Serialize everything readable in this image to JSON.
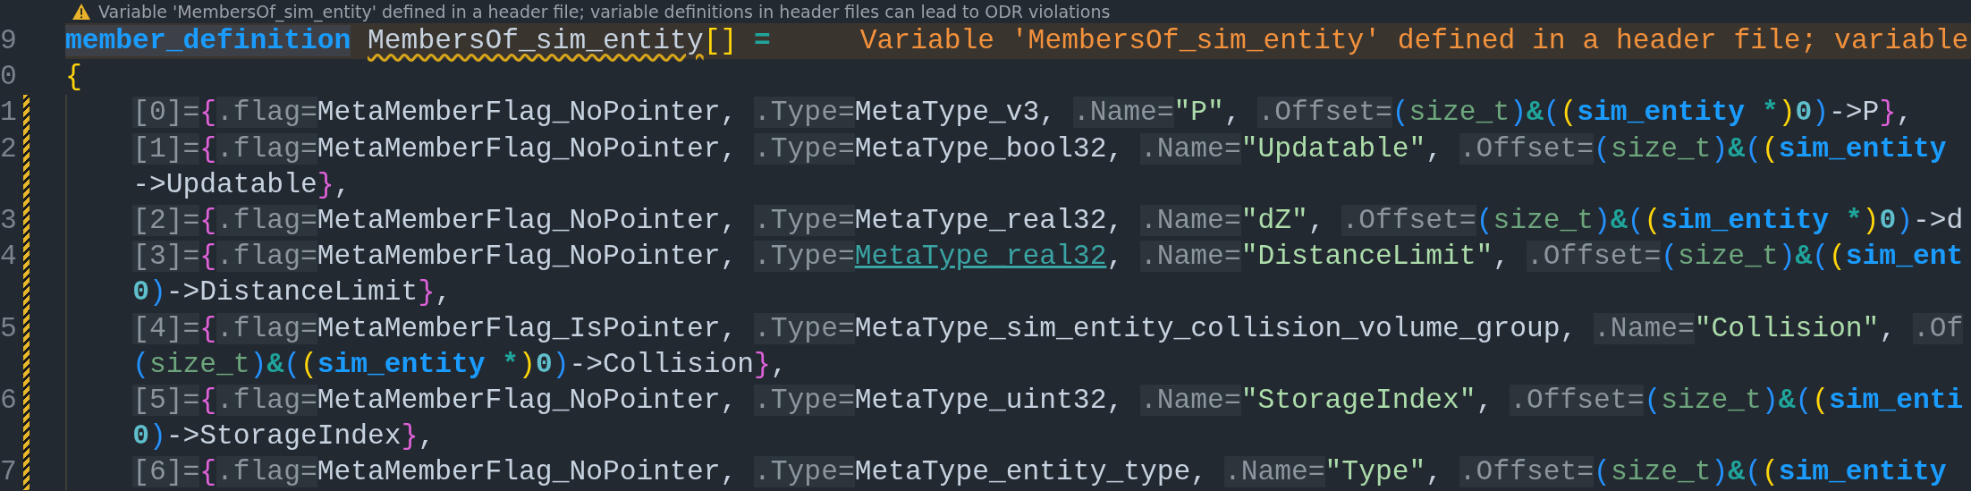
{
  "editor": {
    "codelens": {
      "text": "Variable 'MembersOf_sim_entity' defined in a header file; variable definitions in header files can lead to ODR violations"
    },
    "lines": [
      {
        "number": "9",
        "changed": false,
        "error": "Variable 'MembersOf_sim_entity' defined in a header file; variable",
        "tokens": [
          {
            "kind": "macro",
            "text": "member_definition"
          },
          {
            "kind": "squiggle",
            "text": " MembersOf_sim_entity"
          },
          {
            "kind": "paren-yellow",
            "text": "[]"
          },
          {
            "kind": "op",
            "text": " ="
          }
        ]
      },
      {
        "number": "0",
        "changed": false,
        "tokens": [
          {
            "kind": "brace-yellow",
            "text": "{"
          }
        ]
      },
      {
        "number": "1",
        "changed": true,
        "tokens": [
          {
            "kind": "hint",
            "text": "    [0]="
          },
          {
            "kind": "brace",
            "text": "{"
          },
          {
            "kind": "hint",
            "text": ".flag="
          },
          {
            "kind": "plain",
            "text": "MetaMemberFlag_NoPointer, "
          },
          {
            "kind": "hint",
            "text": ".Type="
          },
          {
            "kind": "plain",
            "text": "MetaType_v3, "
          },
          {
            "kind": "hint",
            "text": ".Name="
          },
          {
            "kind": "string",
            "text": "\"P\""
          },
          {
            "kind": "plain",
            "text": ", "
          },
          {
            "kind": "hint",
            "text": ".Offset="
          },
          {
            "kind": "paren-blue",
            "text": "("
          },
          {
            "kind": "builtin",
            "text": "size_t"
          },
          {
            "kind": "paren-blue",
            "text": ")"
          },
          {
            "kind": "op",
            "text": "&"
          },
          {
            "kind": "paren-blue",
            "text": "("
          },
          {
            "kind": "paren-yellow",
            "text": "("
          },
          {
            "kind": "type",
            "text": "sim_entity"
          },
          {
            "kind": "op",
            "text": " *"
          },
          {
            "kind": "paren-yellow",
            "text": ")"
          },
          {
            "kind": "number",
            "text": "0"
          },
          {
            "kind": "paren-blue",
            "text": ")"
          },
          {
            "kind": "plain",
            "text": "->P"
          },
          {
            "kind": "brace",
            "text": "}"
          },
          {
            "kind": "plain",
            "text": ","
          }
        ]
      },
      {
        "number": "2",
        "changed": true,
        "tokens": [
          {
            "kind": "hint",
            "text": "    [1]="
          },
          {
            "kind": "brace",
            "text": "{"
          },
          {
            "kind": "hint",
            "text": ".flag="
          },
          {
            "kind": "plain",
            "text": "MetaMemberFlag_NoPointer, "
          },
          {
            "kind": "hint",
            "text": ".Type="
          },
          {
            "kind": "plain",
            "text": "MetaType_bool32, "
          },
          {
            "kind": "hint",
            "text": ".Name="
          },
          {
            "kind": "string",
            "text": "\"Updatable\""
          },
          {
            "kind": "plain",
            "text": ", "
          },
          {
            "kind": "hint",
            "text": ".Offset="
          },
          {
            "kind": "paren-blue",
            "text": "("
          },
          {
            "kind": "builtin",
            "text": "size_t"
          },
          {
            "kind": "paren-blue",
            "text": ")"
          },
          {
            "kind": "op",
            "text": "&"
          },
          {
            "kind": "paren-blue",
            "text": "("
          },
          {
            "kind": "paren-yellow",
            "text": "("
          },
          {
            "kind": "type",
            "text": "sim_entity"
          }
        ]
      },
      {
        "changed": true,
        "tokens": [
          {
            "kind": "plain",
            "text": "    ->Updatable"
          },
          {
            "kind": "brace",
            "text": "}"
          },
          {
            "kind": "plain",
            "text": ","
          }
        ]
      },
      {
        "number": "3",
        "changed": true,
        "tokens": [
          {
            "kind": "hint",
            "text": "    [2]="
          },
          {
            "kind": "brace",
            "text": "{"
          },
          {
            "kind": "hint",
            "text": ".flag="
          },
          {
            "kind": "plain",
            "text": "MetaMemberFlag_NoPointer, "
          },
          {
            "kind": "hint",
            "text": ".Type="
          },
          {
            "kind": "plain",
            "text": "MetaType_real32, "
          },
          {
            "kind": "hint",
            "text": ".Name="
          },
          {
            "kind": "string",
            "text": "\"dZ\""
          },
          {
            "kind": "plain",
            "text": ", "
          },
          {
            "kind": "hint",
            "text": ".Offset="
          },
          {
            "kind": "paren-blue",
            "text": "("
          },
          {
            "kind": "builtin",
            "text": "size_t"
          },
          {
            "kind": "paren-blue",
            "text": ")"
          },
          {
            "kind": "op",
            "text": "&"
          },
          {
            "kind": "paren-blue",
            "text": "("
          },
          {
            "kind": "paren-yellow",
            "text": "("
          },
          {
            "kind": "type",
            "text": "sim_entity"
          },
          {
            "kind": "op",
            "text": " *"
          },
          {
            "kind": "paren-yellow",
            "text": ")"
          },
          {
            "kind": "number",
            "text": "0"
          },
          {
            "kind": "paren-blue",
            "text": ")"
          },
          {
            "kind": "plain",
            "text": "->d"
          }
        ]
      },
      {
        "number": "4",
        "changed": true,
        "tokens": [
          {
            "kind": "hint",
            "text": "    [3]="
          },
          {
            "kind": "brace",
            "text": "{"
          },
          {
            "kind": "hint",
            "text": ".flag="
          },
          {
            "kind": "plain",
            "text": "MetaMemberFlag_NoPointer, "
          },
          {
            "kind": "hint",
            "text": ".Type="
          },
          {
            "kind": "link",
            "text": "MetaType_real32"
          },
          {
            "kind": "plain",
            "text": ", "
          },
          {
            "kind": "hint",
            "text": ".Name="
          },
          {
            "kind": "string",
            "text": "\"DistanceLimit\""
          },
          {
            "kind": "plain",
            "text": ", "
          },
          {
            "kind": "hint",
            "text": ".Offset="
          },
          {
            "kind": "paren-blue",
            "text": "("
          },
          {
            "kind": "builtin",
            "text": "size_t"
          },
          {
            "kind": "paren-blue",
            "text": ")"
          },
          {
            "kind": "op",
            "text": "&"
          },
          {
            "kind": "paren-blue",
            "text": "("
          },
          {
            "kind": "paren-yellow",
            "text": "("
          },
          {
            "kind": "type",
            "text": "sim_ent"
          }
        ]
      },
      {
        "changed": true,
        "tokens": [
          {
            "kind": "number",
            "text": "    0"
          },
          {
            "kind": "paren-blue",
            "text": ")"
          },
          {
            "kind": "plain",
            "text": "->DistanceLimit"
          },
          {
            "kind": "brace",
            "text": "}"
          },
          {
            "kind": "plain",
            "text": ","
          }
        ]
      },
      {
        "number": "5",
        "changed": true,
        "tokens": [
          {
            "kind": "hint",
            "text": "    [4]="
          },
          {
            "kind": "brace",
            "text": "{"
          },
          {
            "kind": "hint",
            "text": ".flag="
          },
          {
            "kind": "plain",
            "text": "MetaMemberFlag_IsPointer, "
          },
          {
            "kind": "hint",
            "text": ".Type="
          },
          {
            "kind": "plain",
            "text": "MetaType_sim_entity_collision_volume_group, "
          },
          {
            "kind": "hint",
            "text": ".Name="
          },
          {
            "kind": "string",
            "text": "\"Collision\""
          },
          {
            "kind": "plain",
            "text": ", "
          },
          {
            "kind": "hint",
            "text": ".Of"
          }
        ]
      },
      {
        "changed": true,
        "tokens": [
          {
            "kind": "paren-blue",
            "text": "    ("
          },
          {
            "kind": "builtin",
            "text": "size_t"
          },
          {
            "kind": "paren-blue",
            "text": ")"
          },
          {
            "kind": "op",
            "text": "&"
          },
          {
            "kind": "paren-blue",
            "text": "("
          },
          {
            "kind": "paren-yellow",
            "text": "("
          },
          {
            "kind": "type",
            "text": "sim_entity"
          },
          {
            "kind": "op",
            "text": " *"
          },
          {
            "kind": "paren-yellow",
            "text": ")"
          },
          {
            "kind": "number",
            "text": "0"
          },
          {
            "kind": "paren-blue",
            "text": ")"
          },
          {
            "kind": "plain",
            "text": "->Collision"
          },
          {
            "kind": "brace",
            "text": "}"
          },
          {
            "kind": "plain",
            "text": ","
          }
        ]
      },
      {
        "number": "6",
        "changed": true,
        "tokens": [
          {
            "kind": "hint",
            "text": "    [5]="
          },
          {
            "kind": "brace",
            "text": "{"
          },
          {
            "kind": "hint",
            "text": ".flag="
          },
          {
            "kind": "plain",
            "text": "MetaMemberFlag_NoPointer, "
          },
          {
            "kind": "hint",
            "text": ".Type="
          },
          {
            "kind": "plain",
            "text": "MetaType_uint32, "
          },
          {
            "kind": "hint",
            "text": ".Name="
          },
          {
            "kind": "string",
            "text": "\"StorageIndex\""
          },
          {
            "kind": "plain",
            "text": ", "
          },
          {
            "kind": "hint",
            "text": ".Offset="
          },
          {
            "kind": "paren-blue",
            "text": "("
          },
          {
            "kind": "builtin",
            "text": "size_t"
          },
          {
            "kind": "paren-blue",
            "text": ")"
          },
          {
            "kind": "op",
            "text": "&"
          },
          {
            "kind": "paren-blue",
            "text": "("
          },
          {
            "kind": "paren-yellow",
            "text": "("
          },
          {
            "kind": "type",
            "text": "sim_enti"
          }
        ]
      },
      {
        "changed": true,
        "tokens": [
          {
            "kind": "number",
            "text": "    0"
          },
          {
            "kind": "paren-blue",
            "text": ")"
          },
          {
            "kind": "plain",
            "text": "->StorageIndex"
          },
          {
            "kind": "brace",
            "text": "}"
          },
          {
            "kind": "plain",
            "text": ","
          }
        ]
      },
      {
        "number": "7",
        "changed": true,
        "tokens": [
          {
            "kind": "hint",
            "text": "    [6]="
          },
          {
            "kind": "brace",
            "text": "{"
          },
          {
            "kind": "hint",
            "text": ".flag="
          },
          {
            "kind": "plain",
            "text": "MetaMemberFlag_NoPointer, "
          },
          {
            "kind": "hint",
            "text": ".Type="
          },
          {
            "kind": "plain",
            "text": "MetaType_entity_type, "
          },
          {
            "kind": "hint",
            "text": ".Name="
          },
          {
            "kind": "string",
            "text": "\"Type\""
          },
          {
            "kind": "plain",
            "text": ", "
          },
          {
            "kind": "hint",
            "text": ".Offset="
          },
          {
            "kind": "paren-blue",
            "text": "("
          },
          {
            "kind": "builtin",
            "text": "size_t"
          },
          {
            "kind": "paren-blue",
            "text": ")"
          },
          {
            "kind": "op",
            "text": "&"
          },
          {
            "kind": "paren-blue",
            "text": "("
          },
          {
            "kind": "paren-yellow",
            "text": "("
          },
          {
            "kind": "type",
            "text": "sim_entity"
          }
        ]
      }
    ]
  }
}
